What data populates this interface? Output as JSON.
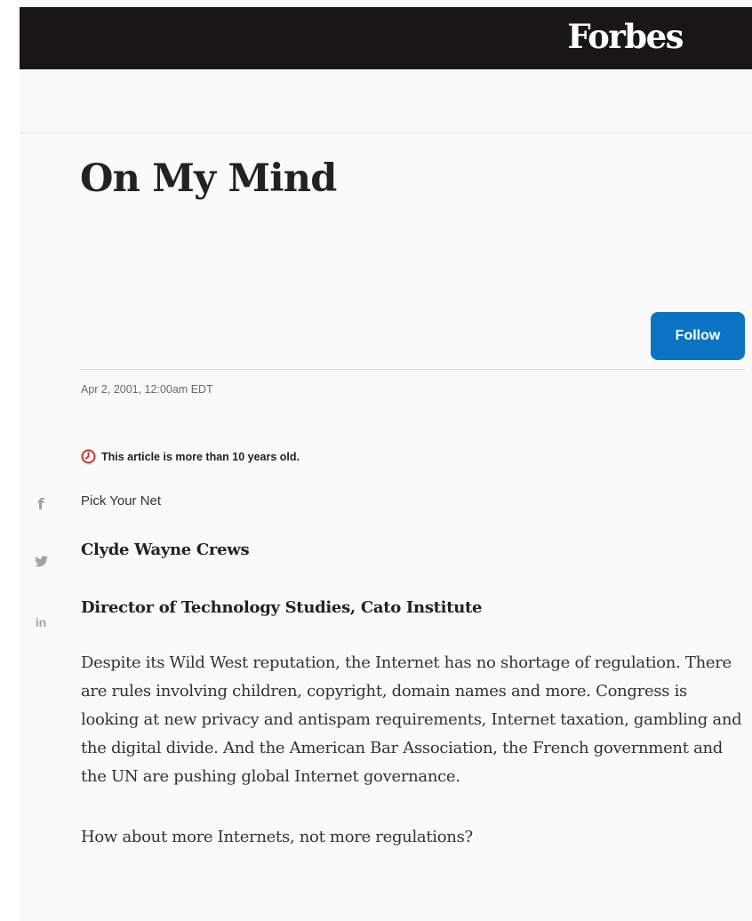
{
  "header": {
    "logo": "Forbes"
  },
  "article": {
    "title": "On My Mind",
    "follow_label": "Follow",
    "date": "Apr 2, 2001, 12:00am EDT",
    "age_notice": "This article is more than 10 years old.",
    "kicker": "Pick Your Net",
    "author_name": "Clyde Wayne Crews",
    "author_title": "Director of Technology Studies, Cato Institute",
    "paragraphs": [
      "Despite its Wild West reputation, the Internet has no shortage of regulation. There are rules involving children, copyright, domain names and more. Congress is looking at new privacy and antispam requirements, Internet taxation, gambling and the digital divide. And the American Bar Association, the French government and the UN are pushing global Internet governance.",
      "How about more Internets, not more regulations?"
    ]
  },
  "share": {
    "facebook": "f",
    "twitter": "twitter-icon",
    "linkedin": "in"
  },
  "colors": {
    "topbar": "#181716",
    "follow_button": "#0a73c4",
    "age_notice_icon": "#d0302f",
    "share_icons": "#a3a3a3"
  }
}
